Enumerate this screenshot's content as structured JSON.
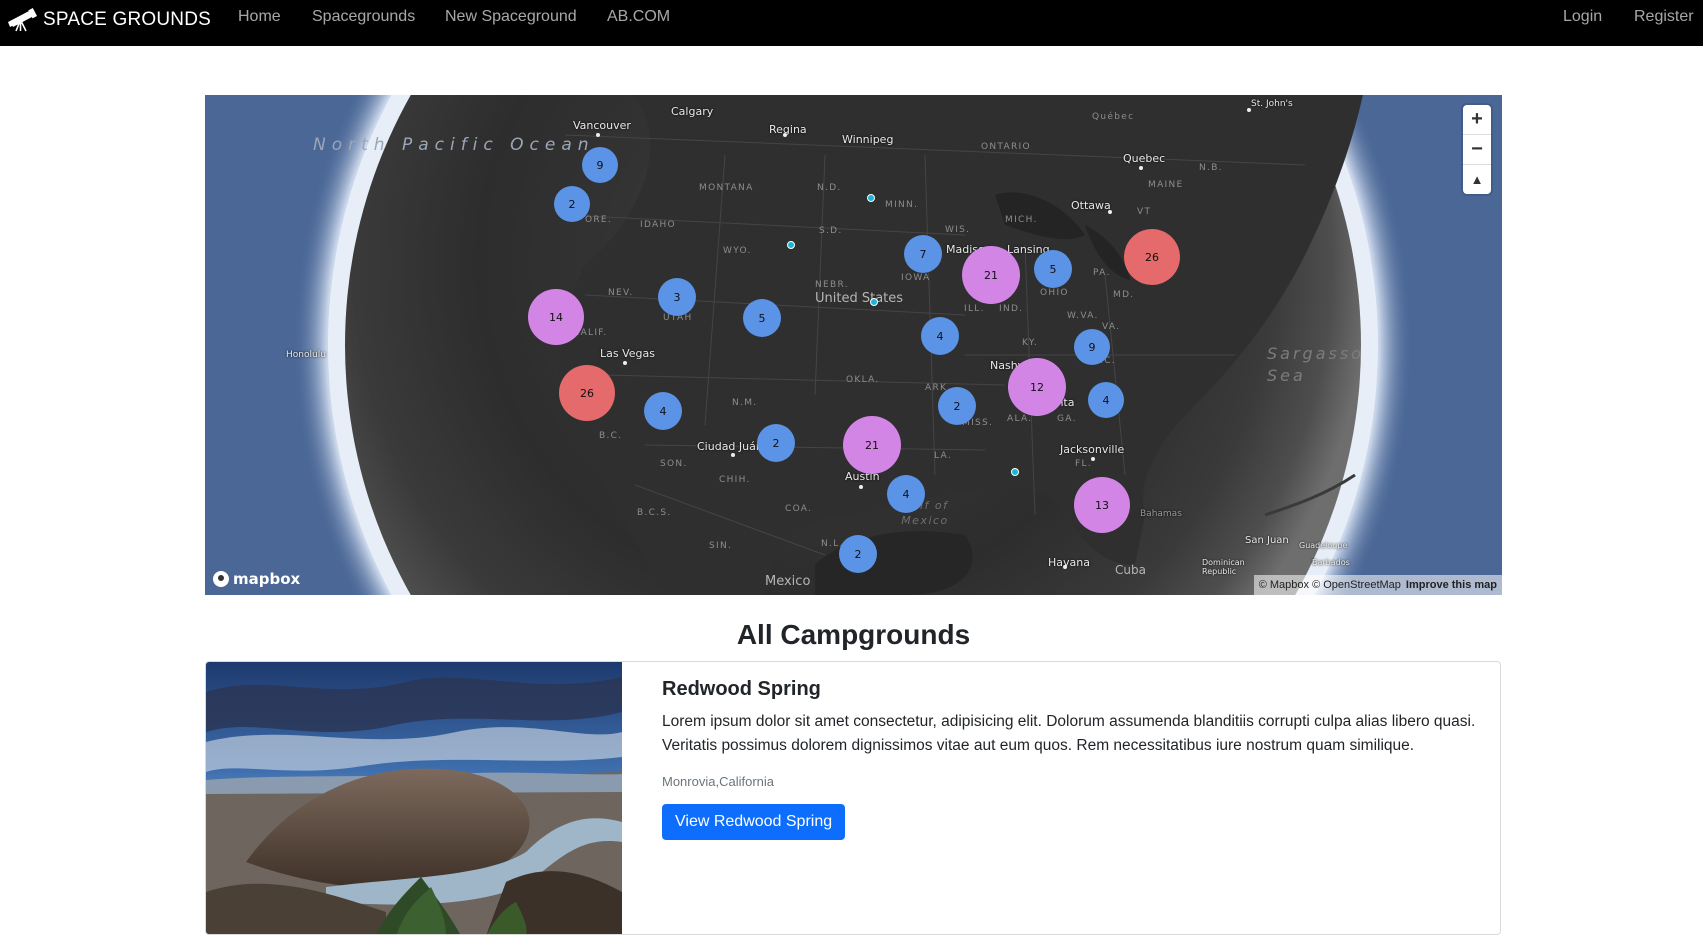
{
  "nav": {
    "brand": "SPACE GROUNDS",
    "links": [
      "Home",
      "Spacegrounds",
      "New Spaceground",
      "AB.COM"
    ],
    "login": "Login",
    "register": "Register"
  },
  "map": {
    "cities": [
      "Calgary",
      "Vancouver",
      "Regina",
      "Winnipeg",
      "Québec",
      "St. John's",
      "Quebec",
      "Ottawa",
      "Madison",
      "Lansing",
      "Las Vegas",
      "Nashville",
      "Atlanta",
      "Jacksonville",
      "Ciudad Juárez",
      "Austin",
      "San Juan",
      "Havana",
      "Honolulu",
      "Guadeloupe",
      "Barbados"
    ],
    "states": [
      "MONTANA",
      "N.D.",
      "MINN.",
      "ONTARIO",
      "MAINE",
      "N.B.",
      "ORE.",
      "IDAHO",
      "WYO.",
      "S.D.",
      "WIS.",
      "MICH.",
      "VT",
      "IOWA",
      "NEBR.",
      "NEV.",
      "UTAH",
      "ILL.",
      "IND.",
      "OHIO",
      "PA.",
      "MD.",
      "W.VA.",
      "VA.",
      "KY.",
      "N.C.",
      "CALIF.",
      "OKLA.",
      "N.M.",
      "ARK.",
      "MISS.",
      "ALA.",
      "GA.",
      "B.C.",
      "LA.",
      "SON.",
      "CHIH.",
      "COA.",
      "B.C.S.",
      "N.L.",
      "SIN.",
      "FL."
    ],
    "countries": [
      "United States",
      "Mexico",
      "Cuba",
      "Bahamas",
      "Dominican Republic"
    ],
    "oceans": {
      "north_pacific": "North Pacific Ocean",
      "gulf": "Gulf of Mexico",
      "sargasso": "Sargasso Sea"
    },
    "clusters": [
      {
        "count": "9",
        "size": "small"
      },
      {
        "count": "2",
        "size": "small"
      },
      {
        "count": "3",
        "size": "small"
      },
      {
        "count": "5",
        "size": "small"
      },
      {
        "count": "14",
        "size": "medium"
      },
      {
        "count": "26",
        "size": "large"
      },
      {
        "count": "4",
        "size": "small"
      },
      {
        "count": "2",
        "size": "small"
      },
      {
        "count": "21",
        "size": "medium"
      },
      {
        "count": "7",
        "size": "small"
      },
      {
        "count": "21",
        "size": "medium"
      },
      {
        "count": "5",
        "size": "small"
      },
      {
        "count": "26",
        "size": "large"
      },
      {
        "count": "4",
        "size": "small"
      },
      {
        "count": "9",
        "size": "small"
      },
      {
        "count": "12",
        "size": "medium"
      },
      {
        "count": "2",
        "size": "small"
      },
      {
        "count": "4",
        "size": "small"
      },
      {
        "count": "4",
        "size": "small"
      },
      {
        "count": "13",
        "size": "medium"
      },
      {
        "count": "2",
        "size": "small"
      }
    ],
    "controls": {
      "zoom_in": "+",
      "zoom_out": "−",
      "compass": "▲"
    },
    "logo": "mapbox",
    "attribution": {
      "mapbox": "© Mapbox",
      "osm": "© OpenStreetMap",
      "improve": "Improve this map"
    },
    "colors": {
      "small": "#5b93e6",
      "medium": "#d385e6",
      "large": "#e46a6c",
      "point": "#19b5d8"
    }
  },
  "heading": "All Campgrounds",
  "card": {
    "title": "Redwood Spring",
    "text": "Lorem ipsum dolor sit amet consectetur, adipisicing elit. Dolorum assumenda blanditiis corrupti culpa alias libero quasi. Veritatis possimus dolorem dignissimos vitae aut eum quos. Rem necessitatibus iure nostrum quam similique.",
    "location": "Monrovia,California",
    "button": "View Redwood Spring",
    "button_color": "#0d6efd"
  }
}
